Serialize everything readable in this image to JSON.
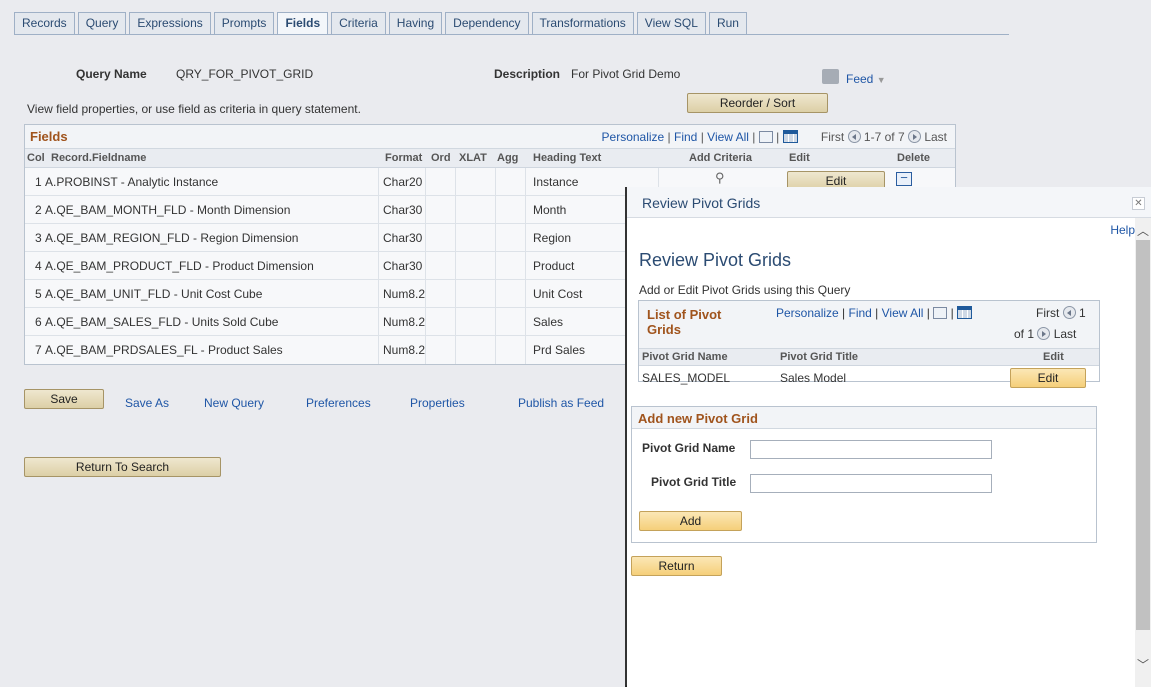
{
  "tabs": [
    "Records",
    "Query",
    "Expressions",
    "Prompts",
    "Fields",
    "Criteria",
    "Having",
    "Dependency",
    "Transformations",
    "View SQL",
    "Run"
  ],
  "active_tab": "Fields",
  "query": {
    "name_label": "Query Name",
    "name_value": "QRY_FOR_PIVOT_GRID",
    "desc_label": "Description",
    "desc_value": "For Pivot Grid Demo",
    "feed_label": "Feed",
    "instructions": "View field properties, or use field as criteria in query statement.",
    "reorder_label": "Reorder / Sort"
  },
  "fields_grid": {
    "title": "Fields",
    "personalize": "Personalize",
    "find": "Find",
    "view_all": "View All",
    "first": "First",
    "range": "1-7 of 7",
    "last": "Last",
    "columns": {
      "col": "Col",
      "record": "Record.Fieldname",
      "format": "Format",
      "ord": "Ord",
      "xlat": "XLAT",
      "agg": "Agg",
      "heading": "Heading Text",
      "add_criteria": "Add Criteria",
      "edit": "Edit",
      "delete": "Delete"
    },
    "rows": [
      {
        "col": "1",
        "record": "A.PROBINST - Analytic Instance",
        "format": "Char20",
        "heading": "Instance"
      },
      {
        "col": "2",
        "record": "A.QE_BAM_MONTH_FLD - Month Dimension",
        "format": "Char30",
        "heading": "Month"
      },
      {
        "col": "3",
        "record": "A.QE_BAM_REGION_FLD - Region Dimension",
        "format": "Char30",
        "heading": "Region"
      },
      {
        "col": "4",
        "record": "A.QE_BAM_PRODUCT_FLD - Product Dimension",
        "format": "Char30",
        "heading": "Product"
      },
      {
        "col": "5",
        "record": "A.QE_BAM_UNIT_FLD - Unit Cost Cube",
        "format": "Num8.2",
        "heading": "Unit Cost"
      },
      {
        "col": "6",
        "record": "A.QE_BAM_SALES_FLD - Units Sold Cube",
        "format": "Num8.2",
        "heading": "Sales"
      },
      {
        "col": "7",
        "record": "A.QE_BAM_PRDSALES_FL - Product Sales",
        "format": "Num8.2",
        "heading": "Prd Sales"
      }
    ],
    "edit_label": "Edit"
  },
  "actions": {
    "save": "Save",
    "save_as": "Save As",
    "new_query": "New Query",
    "preferences": "Preferences",
    "properties": "Properties",
    "publish_feed": "Publish as Feed",
    "return_search": "Return To Search"
  },
  "modal": {
    "window_title": "Review Pivot Grids",
    "help": "Help",
    "heading": "Review Pivot Grids",
    "subtitle": "Add or Edit Pivot Grids using this Query",
    "list": {
      "title_line1": "List of Pivot",
      "title_line2": "Grids",
      "personalize": "Personalize",
      "find": "Find",
      "view_all": "View All",
      "first": "First",
      "page_of_1": "1",
      "page_of_2": "of 1",
      "last": "Last",
      "col_name": "Pivot Grid Name",
      "col_title": "Pivot Grid Title",
      "col_edit": "Edit",
      "rows": [
        {
          "name": "SALES_MODEL",
          "title": "Sales Model",
          "edit": "Edit"
        }
      ]
    },
    "add_new": {
      "title": "Add new Pivot Grid",
      "name_label": "Pivot Grid Name",
      "name_value": "",
      "title_label": "Pivot Grid Title",
      "title_value": "",
      "add_button": "Add"
    },
    "return_button": "Return"
  }
}
